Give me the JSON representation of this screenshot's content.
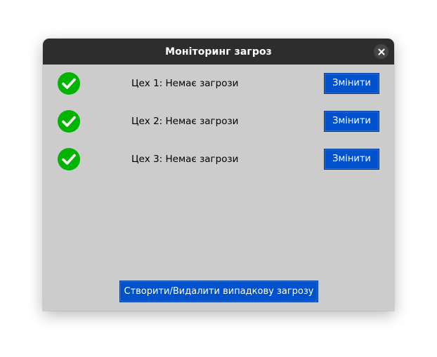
{
  "window": {
    "title": "Моніторинг загроз",
    "close_icon": "close-icon"
  },
  "workshops": [
    {
      "label": "Цех 1: Немає загрози",
      "status": "ok",
      "status_icon": "check-circle-icon",
      "button_label": "Змінити"
    },
    {
      "label": "Цех 2: Немає загрози",
      "status": "ok",
      "status_icon": "check-circle-icon",
      "button_label": "Змінити"
    },
    {
      "label": "Цех 3: Немає загрози",
      "status": "ok",
      "status_icon": "check-circle-icon",
      "button_label": "Змінити"
    }
  ],
  "footer": {
    "random_button_label": "Створити/Видалити випадкову загрозу"
  },
  "colors": {
    "titlebar": "#2d2d2d",
    "background": "#cccccc",
    "button": "#0052cc",
    "status_ok": "#00b400"
  }
}
